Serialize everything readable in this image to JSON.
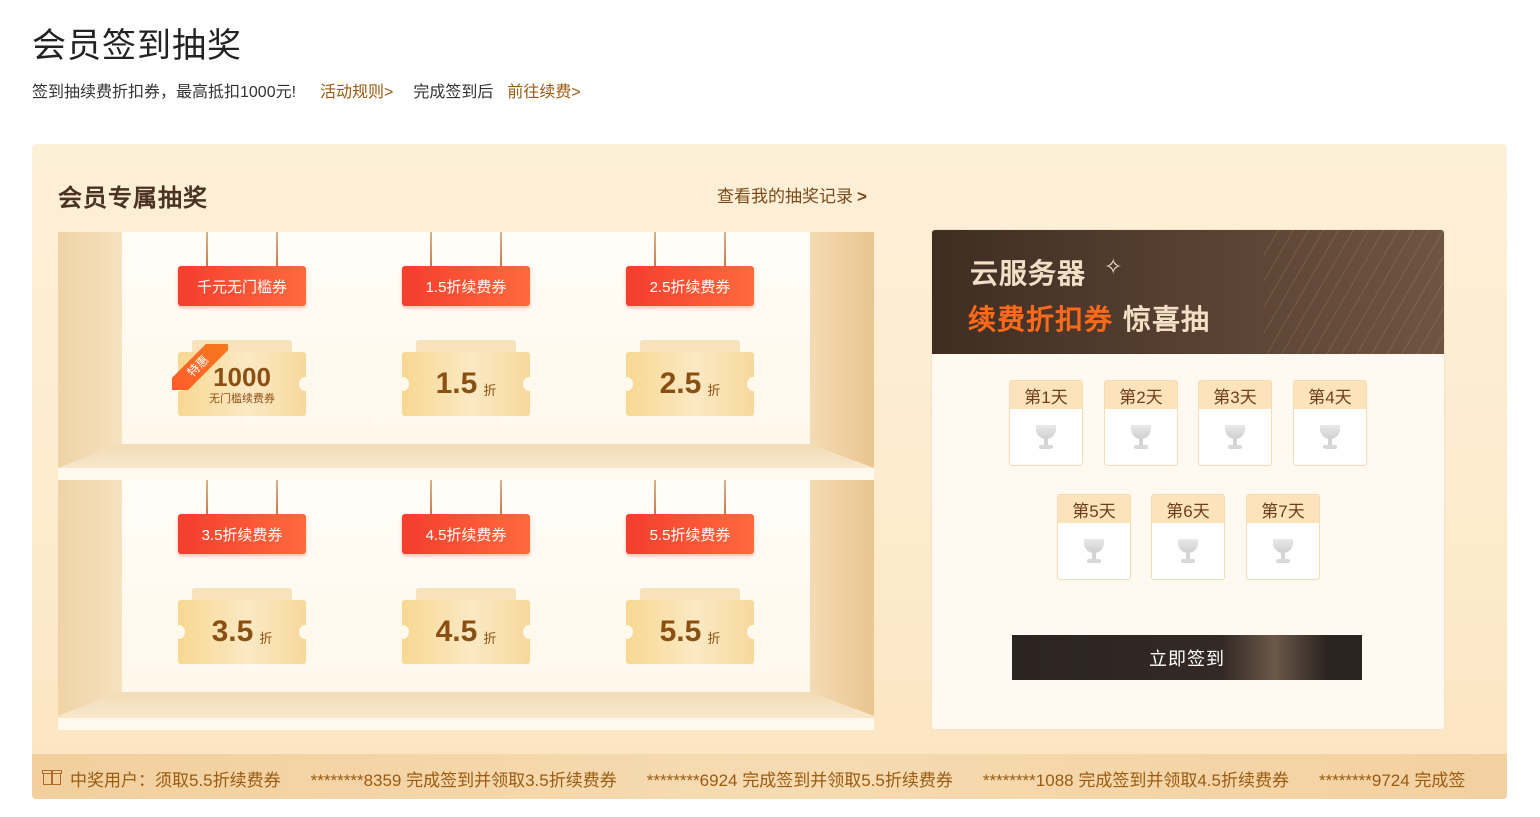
{
  "header": {
    "title": "会员签到抽奖",
    "subtitle": "签到抽续费折扣券，最高抵扣1000元!",
    "rules_link": "活动规则>",
    "after_text": "完成签到后",
    "renew_link": "前往续费>"
  },
  "panel": {
    "title": "会员专属抽奖",
    "records_link": "查看我的抽奖记录",
    "records_chevron": ">"
  },
  "prizes": [
    {
      "tag": "千元无门槛券",
      "value": "1000",
      "sub": "无门槛续费券",
      "ribbon": "特惠"
    },
    {
      "tag": "1.5折续费券",
      "value": "1.5",
      "unit": "折"
    },
    {
      "tag": "2.5折续费券",
      "value": "2.5",
      "unit": "折"
    },
    {
      "tag": "3.5折续费券",
      "value": "3.5",
      "unit": "折"
    },
    {
      "tag": "4.5折续费券",
      "value": "4.5",
      "unit": "折"
    },
    {
      "tag": "5.5折续费券",
      "value": "5.5",
      "unit": "折"
    }
  ],
  "card": {
    "line1": "云服务器",
    "line2_highlight": "续费折扣券",
    "line2_rest": "惊喜抽",
    "days": [
      "第1天",
      "第2天",
      "第3天",
      "第4天",
      "第5天",
      "第6天",
      "第7天"
    ],
    "sign_button": "立即签到"
  },
  "ticker": {
    "items": [
      "中奖用户：须取5.5折续费券",
      "********8359 完成签到并领取3.5折续费券",
      "********6924 完成签到并领取5.5折续费券",
      "********1088 完成签到并领取4.5折续费券",
      "********9724 完成签"
    ]
  },
  "colors": {
    "accent_brown": "#9a5a10",
    "tag_red": "#f43d2f",
    "highlight_orange": "#ff6a1a",
    "card_dark": "#3f2d22"
  }
}
